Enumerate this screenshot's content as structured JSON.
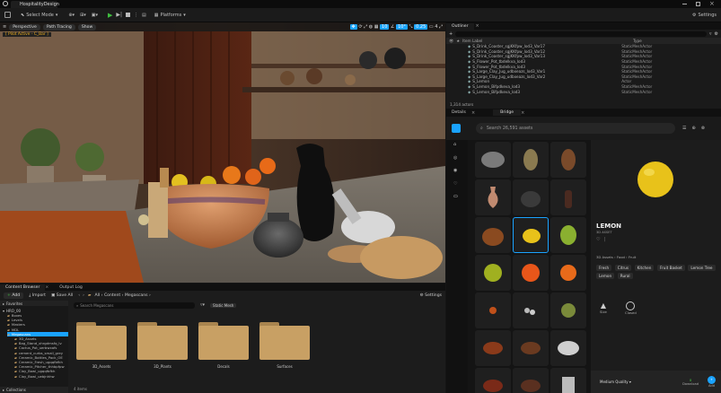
{
  "app": {
    "project_tab": "HospitalityDesign"
  },
  "toolbar": {
    "select_mode": "Select Mode",
    "platforms": "Platforms",
    "settings": "Settings"
  },
  "viewport": {
    "perspective": "Perspective",
    "path_tracing": "Path Tracing",
    "show": "Show",
    "pilot_label": "[ Pilot Active - C_Bar ]",
    "angle": "10°",
    "speed": "0.25",
    "cam_speed": "4"
  },
  "outliner": {
    "tab": "Outliner",
    "col_label": "Item Label",
    "col_type": "Type",
    "actor_count": "1,314 actors",
    "rows": [
      {
        "label": "S_Drink_Coaster_sgjKKfpw_lod3_Var17",
        "type": "StaticMeshActor"
      },
      {
        "label": "S_Drink_Coaster_sgjKKfpw_lod3_Var12",
        "type": "StaticMeshActor"
      },
      {
        "label": "S_Drink_Coaster_sgjKKfpw_lod3_Var13",
        "type": "StaticMeshActor"
      },
      {
        "label": "S_Flower_Pot_tbdelkva_lod3",
        "type": "StaticMeshActor"
      },
      {
        "label": "S_Flower_Pot_tbdelkva_lod3",
        "type": "StaticMeshActor"
      },
      {
        "label": "S_Large_Clay_Jug_udbxeazs_lod3_Var1",
        "type": "StaticMeshActor"
      },
      {
        "label": "S_Large_Clay_Jug_udbxeazs_lod3_Var2",
        "type": "StaticMeshActor"
      },
      {
        "label": "S_Lemon",
        "type": "Actor"
      },
      {
        "label": "S_Lemon_Bifpdkeva_lod3",
        "type": "StaticMeshActor"
      },
      {
        "label": "S_Lemon_Bifpdkeva_lod3",
        "type": "StaticMeshActor"
      }
    ]
  },
  "bridge": {
    "tab_details": "Details",
    "tab_bridge": "Bridge",
    "search_placeholder": "Search 26,591 assets",
    "asset_title": "LEMON",
    "asset_sub": "3D ASSET",
    "breadcrumb": [
      "3D Assets",
      "Food",
      "Fruit"
    ],
    "tags": [
      "Fresh",
      "Citrus",
      "Kitchen",
      "Fruit Basket",
      "Lemon Tree",
      "Lemon",
      "Rural"
    ],
    "size_label": "Size",
    "closed_label": "Closed",
    "quality": "Medium Quality",
    "download_label": "Download",
    "add_label": "Add"
  },
  "content_browser": {
    "tab": "Content Browser",
    "tab_log": "Output Log",
    "add": "Add",
    "import": "Import",
    "save_all": "Save All",
    "path": [
      "All",
      "Content",
      "Megascans"
    ],
    "settings": "Settings",
    "search_placeholder": "Search Megascans",
    "filter_chip": "Static Mesh",
    "favorites": "Favorites",
    "project": "HRO_00",
    "tree": [
      "Boxes",
      "Levels",
      "Masters",
      "MDL",
      "Megascans",
      "3D_Assets",
      "Bag_Stand_xhrgdmsfq_lv",
      "Cactus_Pot_uerbwxafs",
      "cement_curbs_small_grey",
      "Ceramic_Bottles_Pack_OE",
      "Ceramic_Fresh_ugqqfbfkh",
      "Ceramic_Pitcher_thhbpfpw",
      "Clay_Bowl_ugqqfbfkh",
      "Clay_Bowl_uebjnhhw"
    ],
    "collections": "Collections",
    "folders": [
      "3D_Assets",
      "3D_Plants",
      "Decals",
      "Surfaces"
    ],
    "status": "4 items"
  },
  "colors": {
    "accent": "#1aa3ff",
    "lemon": "#e8c21a"
  }
}
